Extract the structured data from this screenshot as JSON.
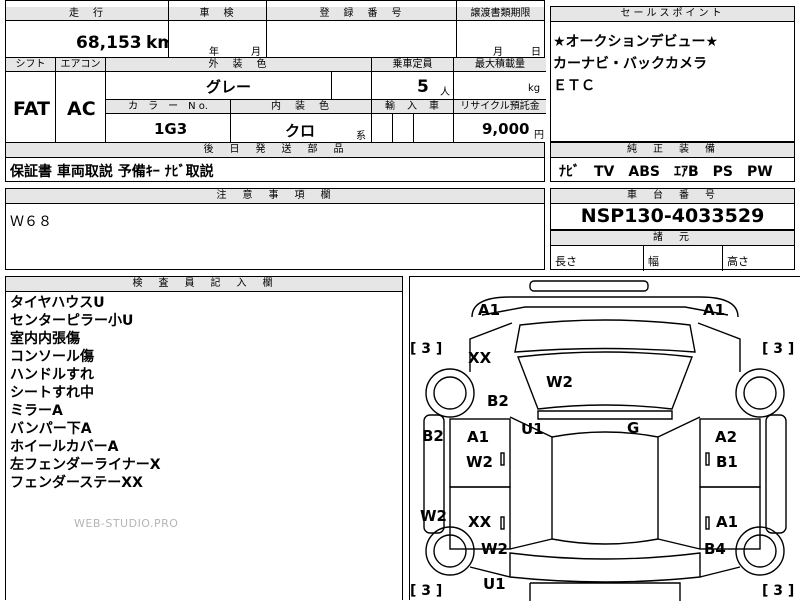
{
  "top": {
    "mileage_label": "走　行",
    "mileage_value": "68,153",
    "mileage_unit": "km",
    "inspection_label": "車　検",
    "inspection_year_unit": "年",
    "inspection_month_unit": "月",
    "reg_label": "登　録　番　号",
    "transfer_label": "譲渡書類期限",
    "transfer_month_unit": "月",
    "transfer_day_unit": "日"
  },
  "row2": {
    "shift_label": "シフト",
    "shift_value": "FAT",
    "ac_label": "エアコン",
    "ac_value": "AC",
    "exterior_label": "外　装　色",
    "exterior_value": "グレー",
    "capacity_label": "乗車定員",
    "capacity_value": "5",
    "capacity_unit": "人",
    "maxload_label": "最大積載量",
    "maxload_unit": "kg",
    "color_no_label": "カ　ラ　ー　N o.",
    "color_no_value": "1G3",
    "interior_label": "内　装　色",
    "interior_value": "クロ",
    "interior_unit": "系",
    "import_label": "輸　入　車",
    "recycle_label": "リサイクル預託金",
    "recycle_value": "9,000",
    "recycle_unit": "円"
  },
  "sales_point": {
    "label": "セールスポイント",
    "lines": [
      "★オークションデビュー★",
      "カーナビ・バックカメラ",
      "ＥＴＣ"
    ]
  },
  "later_parts": {
    "label": "後　日　発　送　部　品",
    "value": "保証書 車両取説 予備ｷｰ ﾅﾋﾞ取説"
  },
  "standard_equipment": {
    "label": "純　正　装　備",
    "value": "ﾅﾋﾞ　TV　ABS　ｴｱB　PS　PW"
  },
  "notes": {
    "label": "注　意　事　項　欄",
    "value": "Ｗ６８"
  },
  "chassis": {
    "label": "車　台　番　号",
    "value": "NSP130-4033529"
  },
  "dimensions": {
    "label": "諸　元",
    "length_label": "長さ",
    "width_label": "幅",
    "height_label": "高さ"
  },
  "inspector": {
    "label": "検　査　員　記　入　欄",
    "items": [
      "タイヤハウスU",
      "センターピラー小U",
      "室内内張傷",
      "コンソール傷",
      "ハンドルすれ",
      "シートすれ中",
      "ミラーA",
      "バンパー下A",
      "ホイールカバーA",
      "左フェンダーライナーX",
      "フェンダーステーXX"
    ],
    "watermark": "WEB-STUDIO.PRO"
  },
  "diagram": {
    "marks": {
      "front_left_a1": "A1",
      "front_right_a1": "A1",
      "bracket_left_top": "[ 3 ]",
      "bracket_right_top": "[ 3 ]",
      "hood_left_xx": "XX",
      "windshield_w2": "W2",
      "left_b2_upper": "B2",
      "left_u1": "U1",
      "center_g": "G",
      "side_b2": "B2",
      "left_door_a1": "A1",
      "left_door_w2": "W2",
      "right_door_a2": "A2",
      "right_door_b1": "B1",
      "side_w2": "W2",
      "rear_left_xx": "XX",
      "right_rear_a1": "A1",
      "rear_left_w2": "W2",
      "right_b4": "B4",
      "rear_u1": "U1",
      "bracket_left_bottom": "[ 3 ]",
      "bracket_right_bottom": "[ 3 ]"
    }
  }
}
